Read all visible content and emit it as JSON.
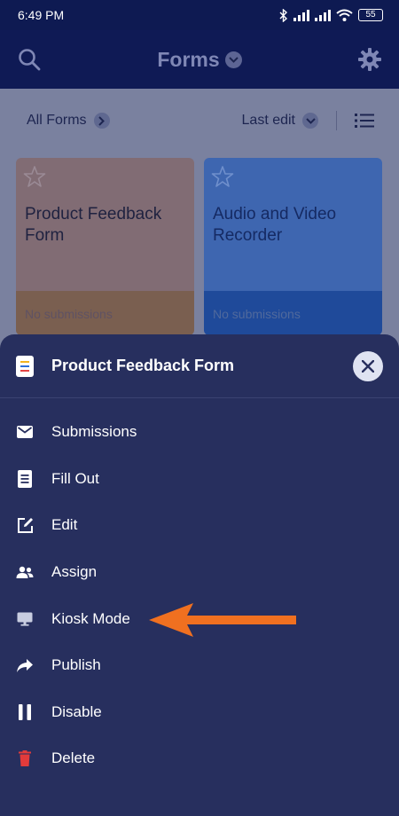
{
  "status": {
    "time": "6:49 PM",
    "battery": "55"
  },
  "appbar": {
    "title": "Forms",
    "search_icon": "search-icon",
    "settings_icon": "gear-icon"
  },
  "subbar": {
    "all_forms": "All Forms",
    "sort": "Last edit"
  },
  "cards": [
    {
      "title": "Product Feedback Form",
      "footer": "No submissions",
      "color": "#816c74"
    },
    {
      "title": "Audio and Video Recorder",
      "footer": "No submissions",
      "color": "#3e66b0"
    }
  ],
  "sheet": {
    "title": "Product Feedback Form",
    "items": [
      {
        "label": "Submissions",
        "icon": "envelope-icon"
      },
      {
        "label": "Fill Out",
        "icon": "document-icon"
      },
      {
        "label": "Edit",
        "icon": "edit-icon"
      },
      {
        "label": "Assign",
        "icon": "people-icon"
      },
      {
        "label": "Kiosk Mode",
        "icon": "monitor-icon"
      },
      {
        "label": "Publish",
        "icon": "share-icon"
      },
      {
        "label": "Disable",
        "icon": "pause-icon"
      },
      {
        "label": "Delete",
        "icon": "trash-icon"
      }
    ]
  },
  "colors": {
    "sheet_bg": "#272f5e",
    "appbar_bg": "#0f1a55",
    "annotation_arrow": "#f07020",
    "delete_icon": "#e23b3b"
  }
}
